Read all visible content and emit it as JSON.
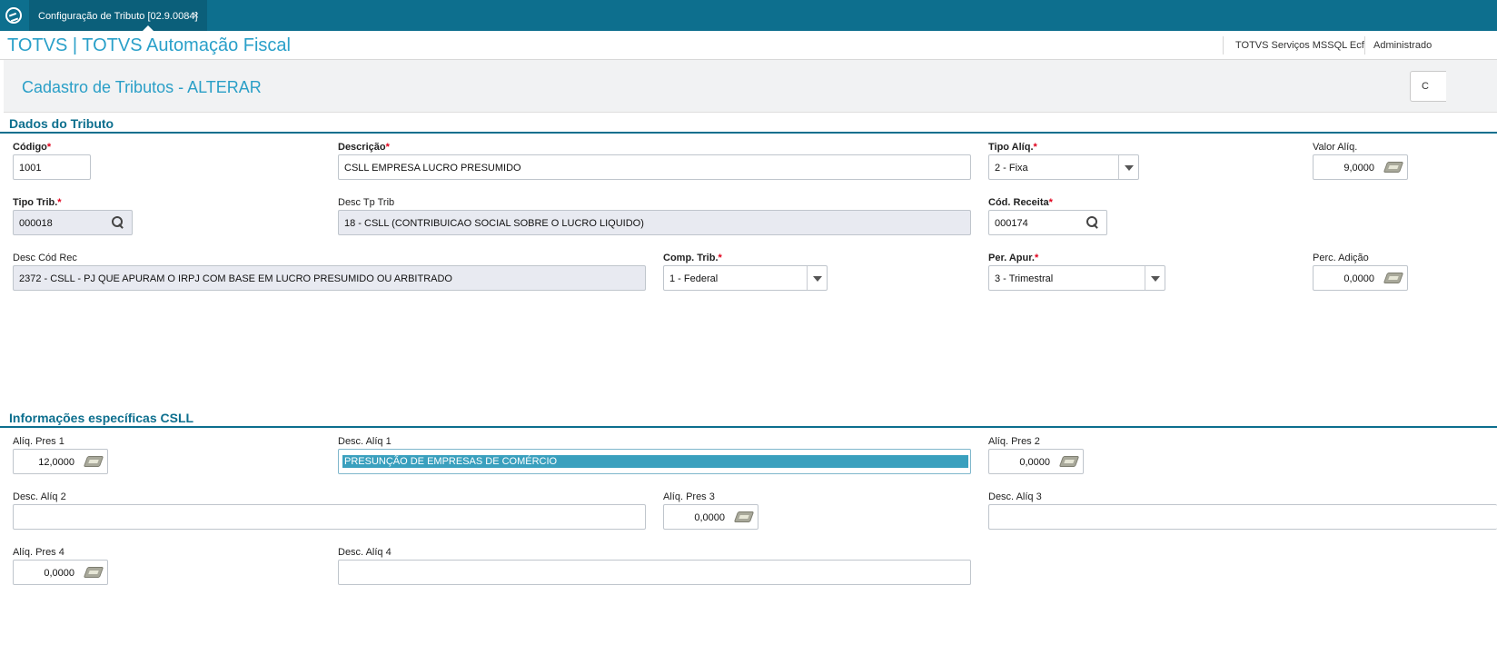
{
  "window": {
    "tab_label": "Configuração de Tributo [02.9.0084]",
    "close_glyph": "×"
  },
  "header": {
    "brand": "TOTVS | TOTVS Automação Fiscal",
    "environment": "TOTVS Serviços MSSQL Ecf",
    "user": "Administrado"
  },
  "page": {
    "title": "Cadastro de Tributos - ALTERAR",
    "top_button_label": "C"
  },
  "sections": {
    "dados": "Dados do Tributo",
    "csll": "Informações específicas CSLL"
  },
  "fields": {
    "codigo": {
      "label": "Código",
      "value": "1001"
    },
    "descricao": {
      "label": "Descrição",
      "value": "CSLL EMPRESA LUCRO PRESUMIDO"
    },
    "tipo_aliq": {
      "label": "Tipo Alíq.",
      "value": "2 - Fixa"
    },
    "valor_aliq": {
      "label": "Valor Alíq.",
      "value": "9,0000"
    },
    "tipo_trib": {
      "label": "Tipo Trib.",
      "value": "000018"
    },
    "desc_tp_trib": {
      "label": "Desc Tp Trib",
      "value": "18 - CSLL (CONTRIBUICAO SOCIAL SOBRE O LUCRO LIQUIDO)"
    },
    "cod_receita": {
      "label": "Cód. Receita",
      "value": "000174"
    },
    "desc_cod_rec": {
      "label": "Desc Cód Rec",
      "value": "2372 - CSLL - PJ QUE APURAM O IRPJ COM BASE EM LUCRO PRESUMIDO OU ARBITRADO"
    },
    "comp_trib": {
      "label": "Comp. Trib.",
      "value": "1 - Federal"
    },
    "per_apur": {
      "label": "Per. Apur.",
      "value": "3 - Trimestral"
    },
    "perc_adicao": {
      "label": "Perc. Adição",
      "value": "0,0000"
    },
    "aliq_pres_1": {
      "label": "Alíq. Pres 1",
      "value": "12,0000"
    },
    "desc_aliq_1": {
      "label": "Desc. Alíq 1",
      "value": "PRESUNÇÃO DE EMPRESAS DE COMÉRCIO"
    },
    "aliq_pres_2": {
      "label": "Alíq. Pres 2",
      "value": "0,0000"
    },
    "desc_aliq_2": {
      "label": "Desc. Alíq 2",
      "value": ""
    },
    "aliq_pres_3": {
      "label": "Alíq. Pres 3",
      "value": "0,0000"
    },
    "desc_aliq_3": {
      "label": "Desc. Alíq 3",
      "value": ""
    },
    "aliq_pres_4": {
      "label": "Alíq. Pres 4",
      "value": "0,0000"
    },
    "desc_aliq_4": {
      "label": "Desc. Alíq 4",
      "value": ""
    }
  },
  "required_marker": "*",
  "colors": {
    "titlebar": "#0d6f8e",
    "brand": "#2aa0c9",
    "required": "#e0001b",
    "selection": "#3aa0be"
  }
}
